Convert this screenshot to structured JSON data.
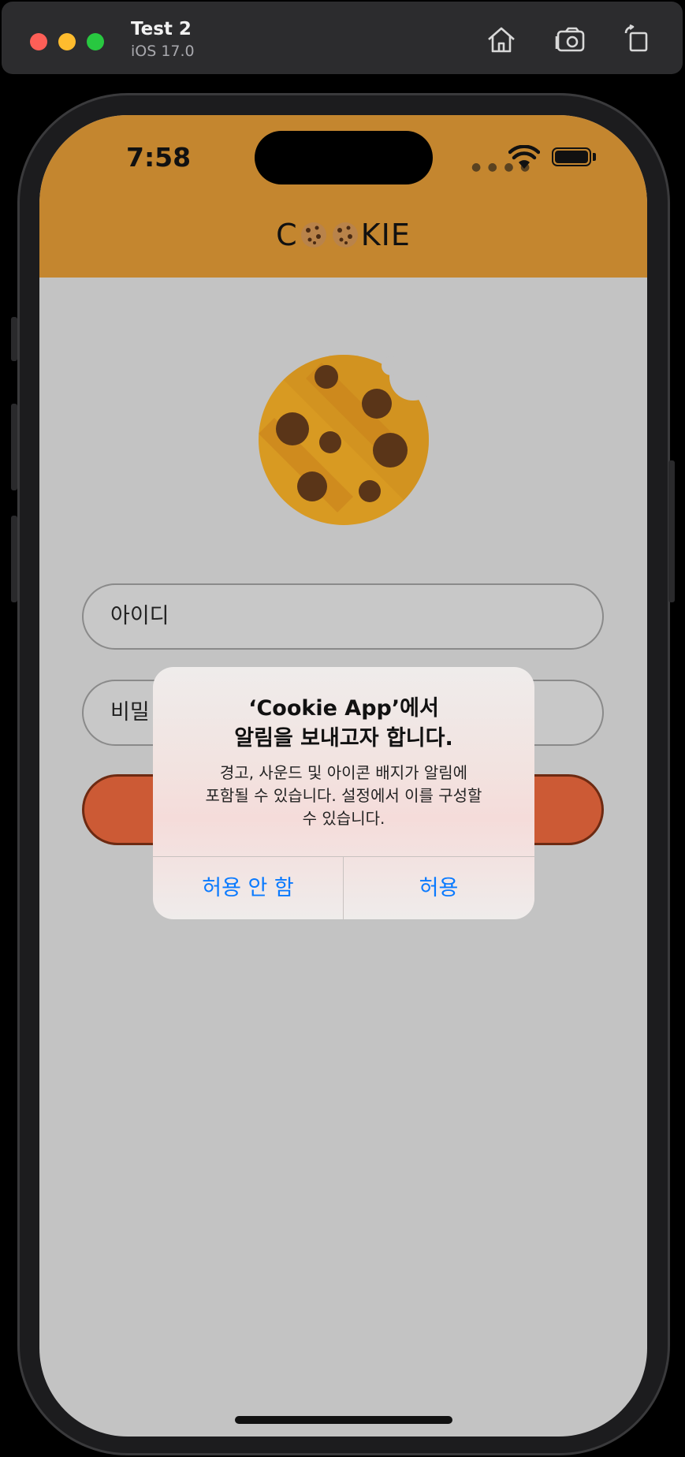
{
  "simulator": {
    "device_name": "Test 2",
    "os_version": "iOS 17.0",
    "toolbar_icons": [
      "home-icon",
      "screenshot-icon",
      "rotate-icon"
    ]
  },
  "status_bar": {
    "time": "7:58",
    "icons": [
      "cellular-dots-icon",
      "wifi-icon",
      "battery-icon"
    ]
  },
  "header": {
    "title_prefix": "C",
    "title_suffix": "KIE",
    "title_emoji": "cookie-emoji-icon",
    "background": "#c4862f"
  },
  "form": {
    "id_placeholder": "아이디",
    "password_placeholder": "비밀",
    "login_button_color": "#cc5a35"
  },
  "alert": {
    "title_line1": "‘Cookie App’에서",
    "title_line2": "알림을 보내고자 합니다.",
    "message_line1": "경고, 사운드 및 아이콘 배지가 알림에",
    "message_line2": "포함될 수 있습니다. 설정에서 이를 구성할",
    "message_line3": "수 있습니다.",
    "deny_label": "허용 안 함",
    "allow_label": "허용",
    "button_color": "#0a7aff"
  }
}
